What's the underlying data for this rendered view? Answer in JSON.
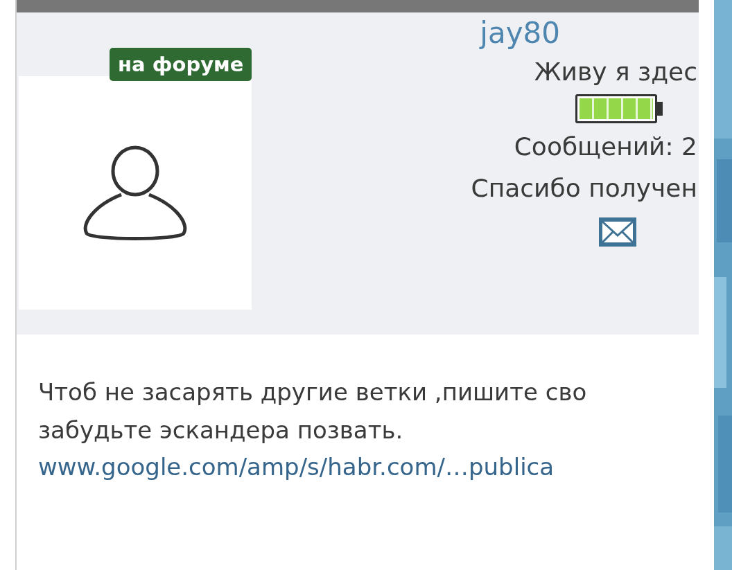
{
  "profile": {
    "status_badge": "на форуме",
    "username": "jay80",
    "location": "Живу я здес",
    "activity": {
      "level": 1.0
    },
    "posts": "Сообщений: 2",
    "thanks": "Спасибо получен"
  },
  "post": {
    "text": "Чтоб не засарять другие ветки ,пишите сво\nзабудьте эскандера позвать.",
    "link": "www.google.com/amp/s/habr.com/…publica"
  }
}
